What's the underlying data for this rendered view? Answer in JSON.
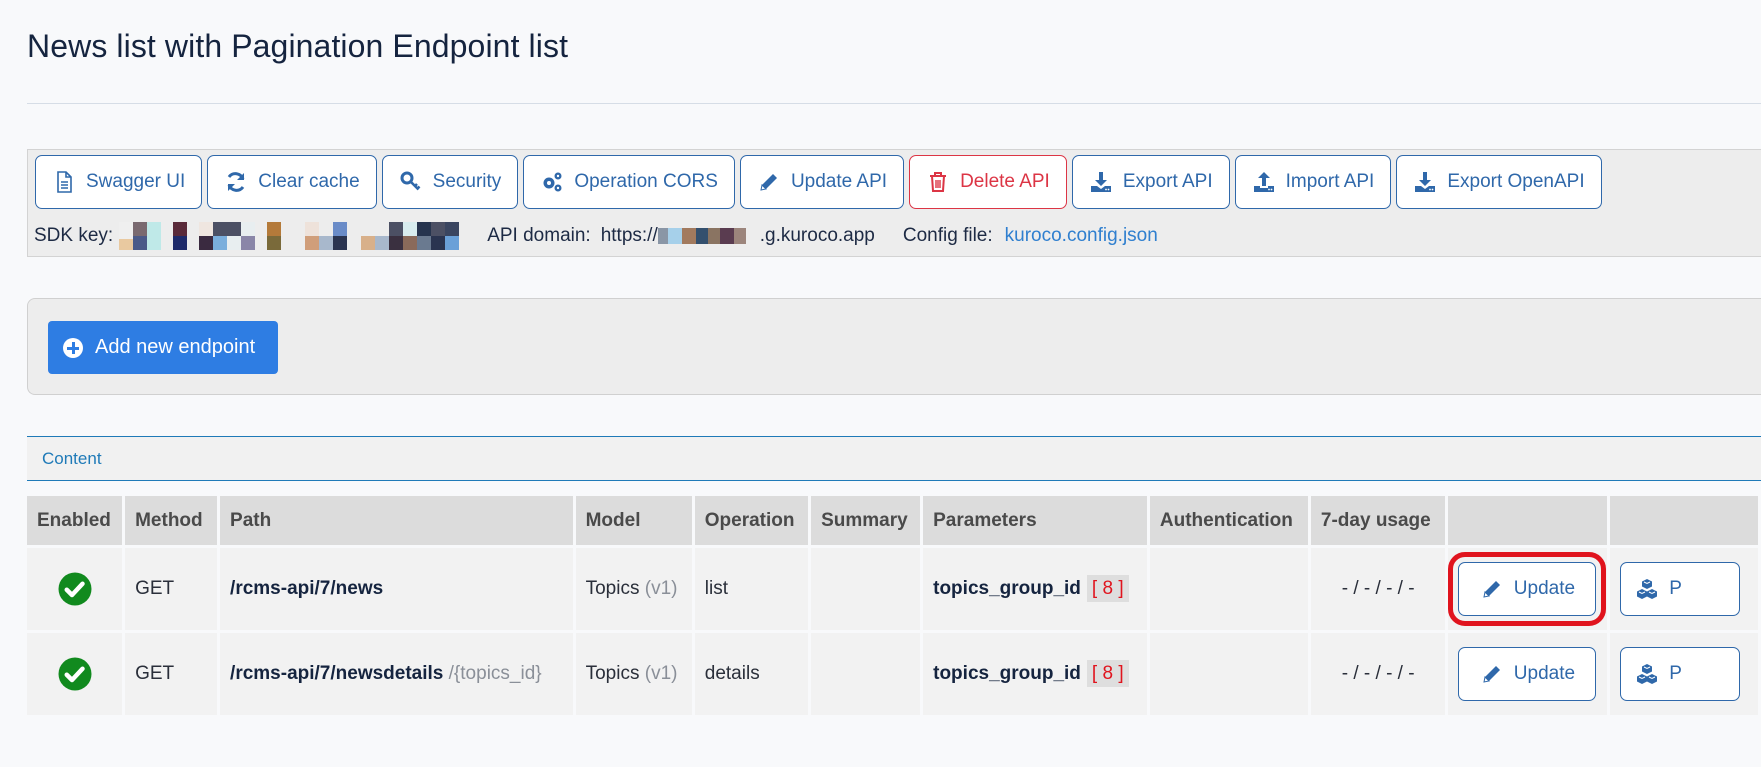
{
  "page": {
    "title": "News list with Pagination Endpoint list"
  },
  "toolbar": {
    "buttons": [
      {
        "label": "Swagger UI",
        "icon": "file-document-icon"
      },
      {
        "label": "Clear cache",
        "icon": "refresh-icon"
      },
      {
        "label": "Security",
        "icon": "key-icon"
      },
      {
        "label": "Operation CORS",
        "icon": "gears-icon"
      },
      {
        "label": "Update API",
        "icon": "pencil-icon"
      },
      {
        "label": "Delete API",
        "icon": "trash-icon"
      },
      {
        "label": "Export API",
        "icon": "download-icon"
      },
      {
        "label": "Import API",
        "icon": "upload-icon"
      },
      {
        "label": "Export OpenAPI",
        "icon": "download-icon"
      }
    ],
    "sdk_key_label": "SDK key:",
    "api_domain_label": "API domain:",
    "api_domain_prefix": "https://",
    "api_domain_suffix": ".g.kuroco.app",
    "config_file_label": "Config file:",
    "config_file_link": "kuroco.config.json"
  },
  "actions": {
    "add_endpoint_label": "Add new endpoint"
  },
  "section": {
    "title": "Content"
  },
  "table": {
    "headers": [
      "Enabled",
      "Method",
      "Path",
      "Model",
      "Operation",
      "Summary",
      "Parameters",
      "Authentication",
      "7-day usage",
      "",
      ""
    ],
    "rows": [
      {
        "enabled": true,
        "method": "GET",
        "path": "/rcms-api/7/news",
        "path_param": "",
        "model": "Topics",
        "model_version": "(v1)",
        "operation": "list",
        "summary": "",
        "param_name": "topics_group_id",
        "param_value": "[ 8 ]",
        "authentication": "",
        "usage": "- / - / - / -",
        "update_label": "Update",
        "second_action_label": "P",
        "highlighted": true
      },
      {
        "enabled": true,
        "method": "GET",
        "path": "/rcms-api/7/newsdetails",
        "path_param": "/{topics_id}",
        "model": "Topics",
        "model_version": "(v1)",
        "operation": "details",
        "summary": "",
        "param_name": "topics_group_id",
        "param_value": "[ 8 ]",
        "authentication": "",
        "usage": "- / - / - / -",
        "update_label": "Update",
        "second_action_label": "P",
        "highlighted": false
      }
    ]
  },
  "colors": {
    "accent": "#2f68aa",
    "primary_button": "#2e7de3",
    "danger": "#dc3545",
    "enabled_check": "#118a1e",
    "highlight": "#e0141e"
  }
}
